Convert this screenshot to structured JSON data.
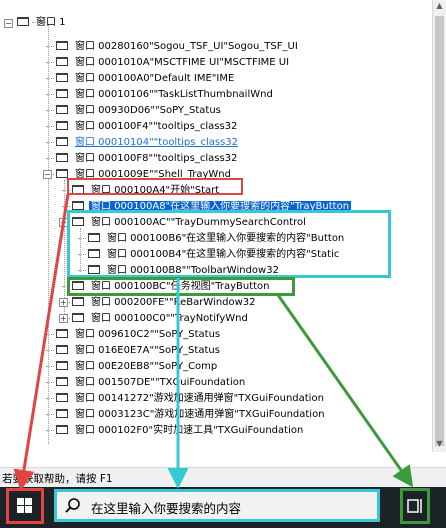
{
  "root": {
    "label": "窗口 1"
  },
  "items": [
    {
      "label": "窗口 00280160\"Sogou_TSF_UI\"Sogou_TSF_UI"
    },
    {
      "label": "窗口 0001010A\"MSCTFIME UI\"MSCTFIME UI"
    },
    {
      "label": "窗口 000100A0\"Default IME\"IME"
    },
    {
      "label": "窗口 00010106\"\"TaskListThumbnailWnd"
    },
    {
      "label": "窗口 00930D06\"\"SoPY_Status"
    },
    {
      "label": "窗口 000100F4\"\"tooltips_class32"
    },
    {
      "label": "窗口 00010104\"\"tooltips_class32"
    },
    {
      "label": "窗口 000100F8\"\"tooltips_class32"
    },
    {
      "label": "窗口 0001009E\"\"Shell_TrayWnd"
    },
    {
      "label": "窗口 000100A4\"开始\"Start"
    },
    {
      "label": "窗口 000100A8\"在这里输入你要搜索的内容\"TrayButton"
    },
    {
      "label": "窗口 000100AC\"\"TrayDummySearchControl"
    },
    {
      "label": "窗口 000100B6\"在这里输入你要搜索的内容\"Button"
    },
    {
      "label": "窗口 000100B4\"在这里输入你要搜索的内容\"Static"
    },
    {
      "label": "窗口 000100B8\"\"ToolbarWindow32"
    },
    {
      "label": "窗口 000100BC\"任务视图\"TrayButton"
    },
    {
      "label": "窗口 000200FE\"\"ReBarWindow32"
    },
    {
      "label": "窗口 000100C0\"\"TrayNotifyWnd"
    },
    {
      "label": "窗口 009610C2\"\"SoPY_Status"
    },
    {
      "label": "窗口 016E0E7A\"\"SoPY_Status"
    },
    {
      "label": "窗口 00E20EB8\"\"SoPY_Comp"
    },
    {
      "label": "窗口 001507DE\"\"TXGuiFoundation"
    },
    {
      "label": "窗口 00141272\"游戏加速通用弹窗\"TXGuiFoundation"
    },
    {
      "label": "窗口 0003123C\"游戏加速通用弹窗\"TXGuiFoundation"
    },
    {
      "label": "窗口 000102F0\"实时加速工具\"TXGuiFoundation"
    }
  ],
  "status_text": "若要获取帮助，请按 F1",
  "search_placeholder": "在这里输入你要搜索的内容",
  "colors": {
    "red": "#e24444",
    "cyan": "#36c8d4",
    "green": "#3c9a3c",
    "selection": "#0a64d2",
    "link": "#1f6fd1"
  }
}
